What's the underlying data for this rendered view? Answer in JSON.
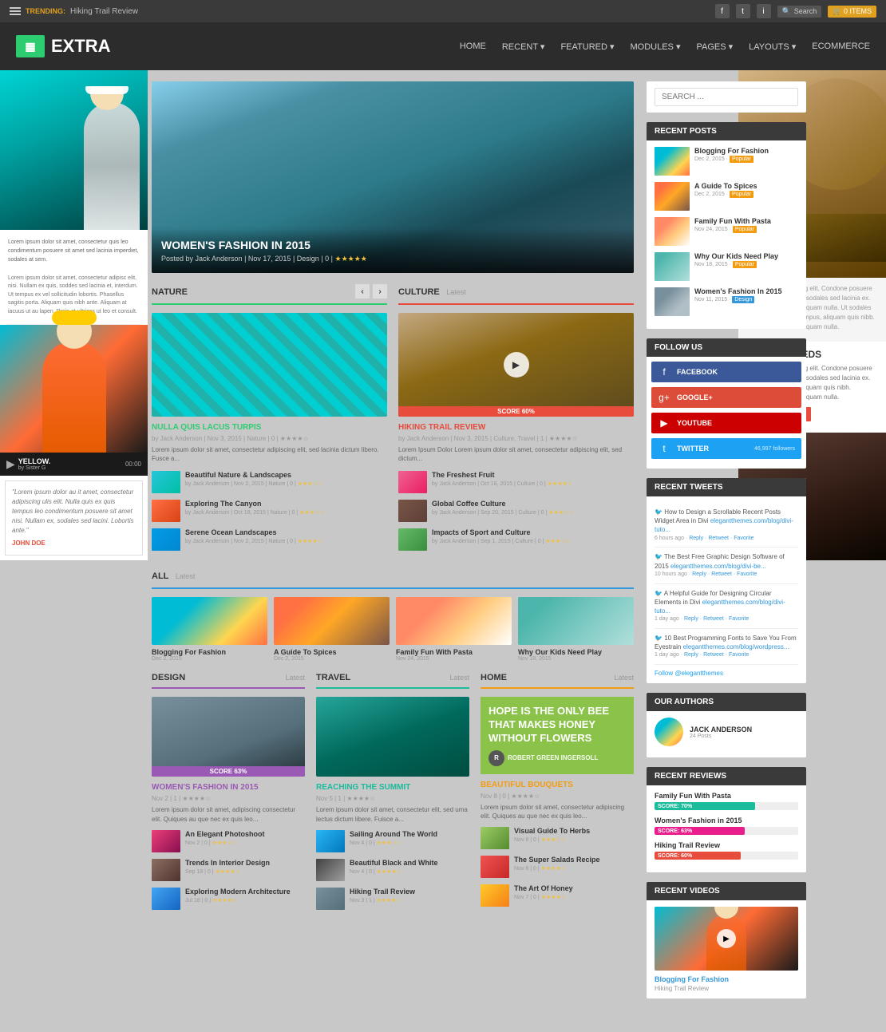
{
  "topbar": {
    "trending_label": "TRENDING:",
    "trending_text": "Hiking Trail Review",
    "search_text": "Search",
    "cart_text": "0 ITEMS"
  },
  "header": {
    "logo_text": "EXTRA",
    "logo_icon": "▦",
    "nav_items": [
      "HOME",
      "RECENT",
      "FEATURED",
      "MODULES",
      "PAGES",
      "LAYOUTS",
      "ECOMMERCE"
    ]
  },
  "hero": {
    "title": "WOMEN'S FASHION IN 2015",
    "meta": "Posted by Jack Anderson | Nov 17, 2015 | Design | 0 |",
    "stars": "★★★★★"
  },
  "nature_section": {
    "title": "NATURE",
    "badge": "",
    "featured_title": "NULLA QUIS LACUS TURPIS",
    "featured_meta": "by Jack Anderson | Nov 3, 2015 | Nature | 0 | ★★★★☆",
    "featured_excerpt": "Lorem ipsum dolor sit amet, consectetur adipiscing elit, sed lacinia dictum libero. Fusce a...",
    "articles": [
      {
        "title": "Beautiful Nature & Landscapes",
        "meta": "by Jack Anderson | Nov 2, 2015 | Nature | 0 |",
        "img_class": "img-nature"
      },
      {
        "title": "Exploring The Canyon",
        "meta": "by Jack Anderson | Oct 18, 2015 | Nature | 0 |",
        "img_class": "img-canyon"
      },
      {
        "title": "Serene Ocean Landscapes",
        "meta": "by Jack Anderson | Nov 2, 2015 | Nature | 0 |",
        "img_class": "img-ocean"
      }
    ]
  },
  "culture_section": {
    "title": "CULTURE",
    "badge": "Latest",
    "score": "SCORE 60%",
    "featured_title": "HIKING TRAIL REVIEW",
    "featured_meta": "by Jack Anderson | Nov 3, 2015 | Culture, Travel | 1 | ★★★★☆",
    "featured_excerpt": "Lorem Ipsum Dolor Lorem ipsum dolor sit amet, consectetur adipiscing elit, sed dictum...",
    "articles": [
      {
        "title": "The Freshest Fruit",
        "meta": "by Jack Anderson | Oct 18, 2015 | Culture | 0 |",
        "img_class": "img-fruit"
      },
      {
        "title": "Global Coffee Culture",
        "meta": "by Jack Anderson | Sep 20, 2015 | Culture | 0 |",
        "img_class": "img-coffee"
      },
      {
        "title": "Impacts of Sport and Culture",
        "meta": "by Jack Anderson | Sep 1, 2015 | Culture | 0 |",
        "img_class": "img-sport"
      }
    ]
  },
  "all_section": {
    "title": "ALL",
    "badge": "Latest",
    "cards": [
      {
        "title": "Blogging For Fashion",
        "date": "Dec 2, 2015",
        "img_class": "img-fashion"
      },
      {
        "title": "A Guide To Spices",
        "date": "Dec 2, 2015",
        "img_class": "img-spices"
      },
      {
        "title": "Family Fun With Pasta",
        "date": "Nov 24, 2015",
        "img_class": "img-pasta"
      },
      {
        "title": "Why Our Kids Need Play",
        "date": "Nov 18, 2015",
        "img_class": "img-kids"
      }
    ]
  },
  "design_section": {
    "title": "DESIGN",
    "badge": "Latest",
    "score": "SCORE 63%",
    "featured_title": "WOMEN'S FASHION IN 2015",
    "featured_meta": "Nov 2 | 1 | ★★★★☆",
    "featured_excerpt": "Lorem ipsum dolor sit amet, adipiscing consectetur elit. Quiques au que nec ex quis leo...",
    "articles": [
      {
        "title": "An Elegant Photoshoot",
        "meta": "Nov 2 | 0 | ★★★☆☆",
        "img_class": "img-photoshoot"
      },
      {
        "title": "Trends In Interior Design",
        "meta": "Sep 18 | 0 | ★★★★☆",
        "img_class": "img-interior"
      },
      {
        "title": "Exploring Modern Architecture",
        "meta": "Jul 18 | 0 | ★★★★☆",
        "img_class": "img-architecture"
      }
    ]
  },
  "travel_section": {
    "title": "TRAVEL",
    "badge": "Latest",
    "featured_title": "REACHING THE SUMMIT",
    "featured_meta": "Nov 5 | 1 | ★★★★☆",
    "featured_excerpt": "Lorem ipsum dolor sit amet, consectetur elit, sed uma lectus dictum libere. Fuisce a...",
    "articles": [
      {
        "title": "Sailing Around The World",
        "meta": "Nov 4 | 0 | ★★★☆☆",
        "img_class": "img-sailing"
      },
      {
        "title": "Beautiful Black and White",
        "meta": "Nov 4 | 0 | ★★★★☆",
        "img_class": "img-black-white"
      },
      {
        "title": "Hiking Trail Review",
        "meta": "Nov 3 | 1 | ★★★★☆",
        "img_class": "img-hiking"
      }
    ]
  },
  "home_section": {
    "title": "HOME",
    "badge": "Latest",
    "promo_text": "HOPE IS THE ONLY BEE THAT MAKES HONEY WITHOUT FLOWERS",
    "author": "Robert Green Ingersoll",
    "featured_title": "BEAUTIFUL BOUQUETS",
    "featured_meta": "Nov 8 | 0 | ★★★★☆",
    "featured_excerpt": "Lorem ipsum dolor sit amet, consectetur adipiscing elit. Quiques au que nec ex quis leo...",
    "articles": [
      {
        "title": "Visual Guide To Herbs",
        "meta": "Nov 8 | 0 | ★★★☆☆",
        "img_class": "img-herbs"
      },
      {
        "title": "The Super Salads Recipe",
        "meta": "Nov 8 | 0 | ★★★★☆",
        "img_class": "img-salad"
      },
      {
        "title": "The Art Of Honey",
        "meta": "Nov 7 | 0 | ★★★★☆",
        "img_class": "img-honey"
      }
    ]
  },
  "sidebar": {
    "search_placeholder": "SEARCH ...",
    "recent_posts_title": "RECENT POSTS",
    "recent_posts": [
      {
        "title": "Blogging For Fashion",
        "date": "Dec 2, 2015",
        "badge": "Popular",
        "img_class": "img-fashion"
      },
      {
        "title": "A Guide To Spices",
        "date": "Dec 2, 2015",
        "badge": "Popular",
        "img_class": "img-spices"
      },
      {
        "title": "Family Fun With Pasta",
        "date": "Nov 24, 2015",
        "badge": "Popular",
        "img_class": "img-pasta"
      },
      {
        "title": "Why Our Kids Need Play",
        "date": "Nov 18, 2015",
        "badge": "Popular",
        "img_class": "img-kids"
      },
      {
        "title": "Women's Fashion In 2015",
        "date": "Nov 11, 2015",
        "badge": "Design",
        "img_class": "img-womens"
      }
    ],
    "follow_title": "FOLLOW US",
    "follow_items": [
      {
        "name": "FACEBOOK",
        "icon": "f",
        "class": "follow-fb"
      },
      {
        "name": "GOOGLE+",
        "icon": "g",
        "class": "follow-gplus"
      },
      {
        "name": "YOUTUBE",
        "icon": "▶",
        "class": "follow-yt"
      },
      {
        "name": "TWITTER",
        "icon": "t",
        "class": "follow-tw",
        "count": "46,997 followers"
      }
    ],
    "tweets_title": "RECENT TWEETS",
    "tweets": [
      {
        "text": "How to Design a Scrollable Recent Posts Widget Area in Divi elegantthemes.com/blog/divi-tuto...",
        "time": "6 hours ago",
        "actions": "Reply · Retweet · Favorite"
      },
      {
        "text": "The Best Free Graphic Design Software of 2015 elegantthemes.com/blog/divi-be...",
        "time": "10 hours ago",
        "actions": "Reply · Retweet · Favorite"
      },
      {
        "text": "A Helpful Guide for Designing Circular Elements in Divi elegantthemes.com/blog/divi-tuto...",
        "time": "1 day ago",
        "actions": "Reply · Retweet · Favorite"
      },
      {
        "text": "10 Best Programming Fonts to Save You From Eyestrain elegantthemes.com/blog/wordpress...",
        "time": "1 day ago",
        "actions": "Reply · Retweet · Favorite"
      }
    ],
    "follow_elegantthemes": "Follow @elegantthemes",
    "authors_title": "OUR AUTHORS",
    "authors": [
      {
        "name": "JACK ANDERSON",
        "posts": "24 Posts"
      }
    ],
    "reviews_title": "RECENT REVIEWS",
    "reviews": [
      {
        "title": "Family Fun With Pasta",
        "score": "SCORE: 70%",
        "width": "70",
        "bar_class": "review-bar-cyan"
      },
      {
        "title": "Women's Fashion in 2015",
        "score": "SCORE: 63%",
        "width": "63",
        "bar_class": "review-bar-pink"
      },
      {
        "title": "Hiking Trail Review",
        "score": "SCORE: 60%",
        "width": "60",
        "bar_class": "review-bar-red"
      }
    ],
    "videos_title": "RECENT VIDEOS",
    "videos": [
      {
        "title": "Blogging For Fashion",
        "sub": "Hiking Trail Review"
      }
    ]
  }
}
